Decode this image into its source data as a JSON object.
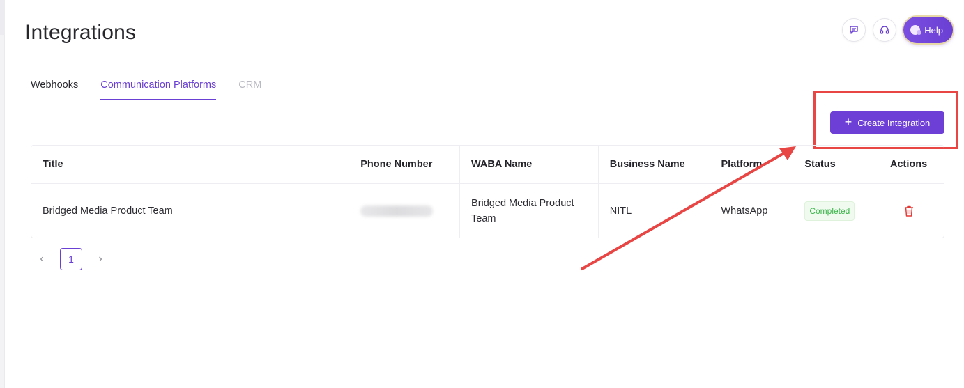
{
  "page": {
    "title": "Integrations"
  },
  "top_actions": {
    "help_label": "Help"
  },
  "tabs": [
    {
      "label": "Webhooks",
      "state": "normal"
    },
    {
      "label": "Communication Platforms",
      "state": "active"
    },
    {
      "label": "CRM",
      "state": "disabled"
    }
  ],
  "toolbar": {
    "create_label": "Create Integration",
    "create_icon": "+"
  },
  "table": {
    "headers": [
      "Title",
      "Phone Number",
      "WABA Name",
      "Business Name",
      "Platform",
      "Status",
      "Actions"
    ],
    "rows": [
      {
        "title": "Bridged Media Product Team",
        "waba_name": "Bridged Media Product Team",
        "business_name": "NITL",
        "platform": "WhatsApp",
        "status": "Completed"
      }
    ]
  },
  "pagination": {
    "current_page": "1",
    "prev_icon": "‹",
    "next_icon": "›"
  },
  "colors": {
    "accent": "#6a3fd3",
    "annotation": "#e84545",
    "status_ok": "#3bb54a",
    "delete": "#e53935"
  }
}
